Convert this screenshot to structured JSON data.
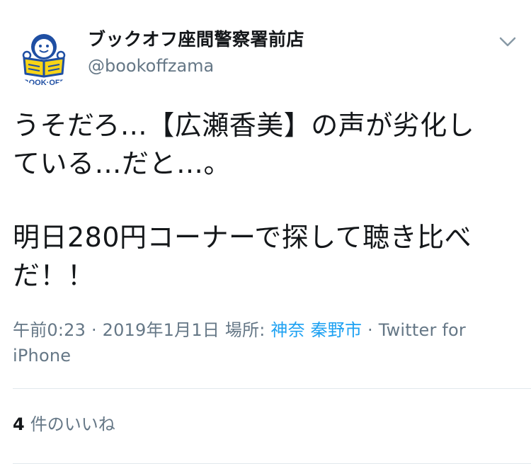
{
  "account": {
    "display_name": "ブックオフ座間警察署前店",
    "handle": "@bookoffzama",
    "avatar_logo_text": "BOOK·OFF"
  },
  "tweet": {
    "paragraph_1": "うそだろ…【広瀬香美】の声が劣化し\nている…だと…。",
    "paragraph_2": "明日280円コーナーで探して聴き比べ\nだ！！"
  },
  "meta": {
    "time": "午前0:23",
    "sep1": " · ",
    "date": "2019年1月1日",
    "place_label": " 場所: ",
    "place_link": "神奈 秦野市",
    "sep2": " · ",
    "client": "Twitter for iPhone"
  },
  "likes": {
    "count": "4",
    "label": "件のいいね"
  },
  "icons": {
    "menu": "chevron-down-icon",
    "avatar": "bookoff-logo"
  },
  "colors": {
    "text": "#14171a",
    "secondary": "#657786",
    "link": "#1da1f2",
    "logo_blue": "#1f4fa3",
    "logo_yellow": "#f7d417"
  }
}
